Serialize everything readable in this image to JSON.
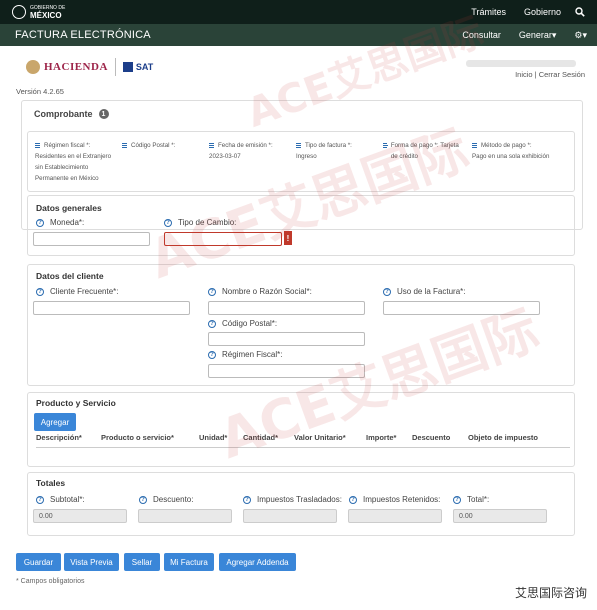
{
  "topbar": {
    "gov_small": "GOBIERNO DE",
    "gov_big": "MÉXICO",
    "nav": [
      "Trámites",
      "Gobierno"
    ],
    "search_icon": "search-icon"
  },
  "secbar": {
    "title": "FACTURA ELECTRÓNICA",
    "nav": [
      "Consultar",
      "Generar▾"
    ],
    "settings_icon": "gear-icon"
  },
  "branding": {
    "hacienda": "HACIENDA",
    "sat": "SAT"
  },
  "session": {
    "links": "Inicio | Cerrar Sesión"
  },
  "version": "Versión 4.2.65",
  "comprobante": {
    "title": "Comprobante",
    "badge": "1",
    "fields": [
      {
        "label": "Régimen fiscal *:",
        "value": "Residentes en el Extranjero sin Establecimiento Permanente en México"
      },
      {
        "label": "Código Postal *:",
        "value": ""
      },
      {
        "label": "Fecha de emisión *:",
        "value": "2023-03-07"
      },
      {
        "label": "Tipo de factura *:",
        "value": "Ingreso"
      },
      {
        "label": "Forma de pago *: Tarjeta de crédito",
        "value": ""
      },
      {
        "label": "Método de pago *:",
        "value": "Pago en una sola exhibición"
      }
    ]
  },
  "datos_generales": {
    "title": "Datos generales",
    "moneda_label": "Moneda*:",
    "tipo_cambio_label": "Tipo de Cambio:",
    "err_flag": "!"
  },
  "datos_cliente": {
    "title": "Datos del cliente",
    "cliente_frecuente": "Cliente Frecuente*:",
    "nombre": "Nombre o Razón Social*:",
    "uso": "Uso de la Factura*:",
    "codigo_postal": "Código Postal*:",
    "regimen": "Régimen Fiscal*:"
  },
  "producto": {
    "title": "Producto y Servicio",
    "add_button": "Agregar",
    "columns": [
      "Descripción*",
      "Producto o servicio*",
      "Unidad*",
      "Cantidad*",
      "Valor Unitario*",
      "Importe*",
      "Descuento",
      "Objeto de impuesto"
    ]
  },
  "totales": {
    "title": "Totales",
    "subtotal_label": "Subtotal*:",
    "descuento_label": "Descuento:",
    "trasladados_label": "Impuestos Trasladados:",
    "retenidos_label": "Impuestos Retenidos:",
    "total_label": "Total*:",
    "subtotal_value": "0.00",
    "total_value": "0.00"
  },
  "actions": [
    "Guardar",
    "Vista Previa",
    "Sellar",
    "Mi Factura",
    "Agregar Addenda"
  ],
  "note": "* Campos obligatorios",
  "watermark": {
    "text": "ACE艾思国际",
    "footer": "艾思国际咨询"
  }
}
